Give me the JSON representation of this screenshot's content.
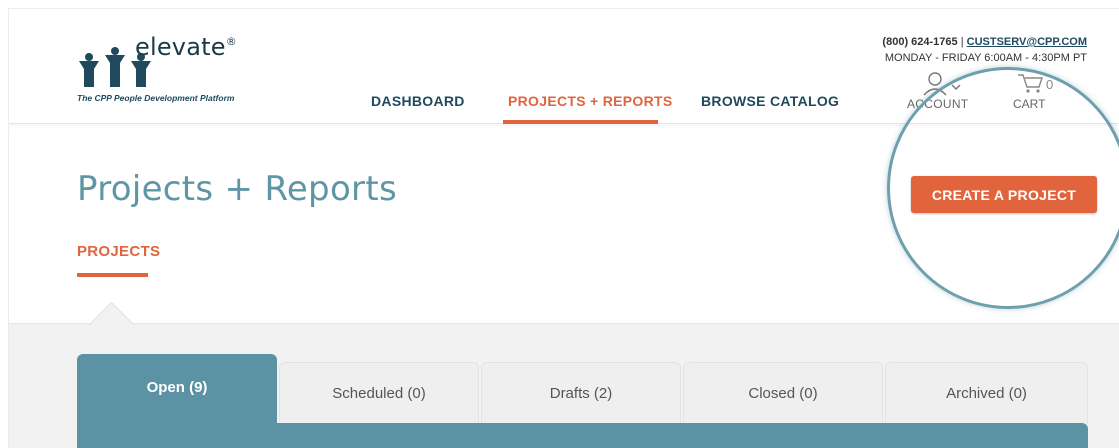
{
  "logo": {
    "name": "elevate",
    "trademark": "®",
    "tagline": "The CPP People Development Platform"
  },
  "nav": {
    "items": [
      {
        "label": "DASHBOARD"
      },
      {
        "label": "PROJECTS + REPORTS"
      },
      {
        "label": "BROWSE CATALOG"
      }
    ],
    "active": "PROJECTS + REPORTS"
  },
  "contact": {
    "phone": "(800) 624-1765",
    "separator": "|",
    "email": "CUSTSERV@CPP.COM",
    "hours": "MONDAY - FRIDAY 6:00AM - 4:30PM PT"
  },
  "account": {
    "label": "ACCOUNT"
  },
  "cart": {
    "label": "CART",
    "count": "0"
  },
  "page": {
    "title": "Projects + Reports",
    "create_button": "CREATE A PROJECT",
    "subtab": "PROJECTS"
  },
  "tabs": [
    {
      "label": "Open (9)",
      "active": true
    },
    {
      "label": "Scheduled (0)",
      "active": false
    },
    {
      "label": "Drafts (2)",
      "active": false
    },
    {
      "label": "Closed (0)",
      "active": false
    },
    {
      "label": "Archived (0)",
      "active": false
    }
  ],
  "colors": {
    "accent": "#e2643d",
    "teal": "#5b93a4",
    "navy": "#1f4a5e"
  }
}
